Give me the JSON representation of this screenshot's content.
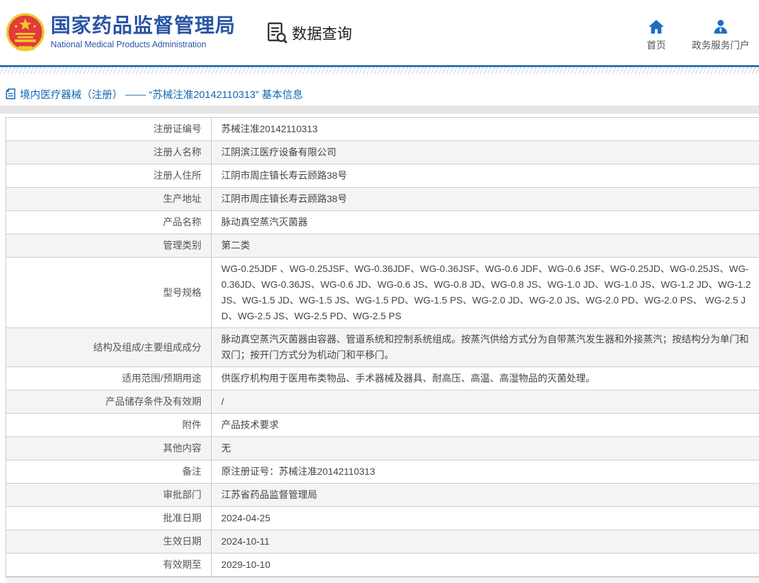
{
  "header": {
    "logo": {
      "title_cn": "国家药品监督管理局",
      "title_en": "National Medical Products Administration"
    },
    "section": {
      "label": "数据查询"
    },
    "nav": [
      {
        "label": "首页",
        "icon": "home-icon"
      },
      {
        "label": "政务服务门户",
        "icon": "user-icon"
      }
    ]
  },
  "breadcrumb": {
    "text": "境内医疗器械（注册） —— “苏械注准20142110313” 基本信息"
  },
  "table": {
    "rows": [
      {
        "label": "注册证编号",
        "value": "苏械注准20142110313"
      },
      {
        "label": "注册人名称",
        "value": "江阴滨江医疗设备有限公司"
      },
      {
        "label": "注册人住所",
        "value": "江阴市周庄镇长寿云顾路38号"
      },
      {
        "label": "生产地址",
        "value": "江阴市周庄镇长寿云顾路38号"
      },
      {
        "label": "产品名称",
        "value": "脉动真空蒸汽灭菌器"
      },
      {
        "label": "管理类别",
        "value": "第二类"
      },
      {
        "label": "型号规格",
        "value": "WG-0.25JDF 、WG-0.25JSF、WG-0.36JDF、WG-0.36JSF、WG-0.6 JDF、WG-0.6 JSF、WG-0.25JD、WG-0.25JS、WG-0.36JD、WG-0.36JS、WG-0.6 JD、WG-0.6 JS、WG-0.8 JD、WG-0.8 JS、WG-1.0 JD、WG-1.0 JS、WG-1.2 JD、WG-1.2 JS、WG-1.5 JD、WG-1.5 JS、WG-1.5 PD、WG-1.5 PS、WG-2.0 JD、WG-2.0 JS、WG-2.0 PD、WG-2.0 PS、 WG-2.5 JD、WG-2.5 JS、WG-2.5 PD、WG-2.5 PS"
      },
      {
        "label": "结构及组成/主要组成成分",
        "value": "脉动真空蒸汽灭菌器由容器、管道系统和控制系统组成。按蒸汽供给方式分为自带蒸汽发生器和外接蒸汽；按结构分为单门和双门；按开门方式分为机动门和平移门。"
      },
      {
        "label": "适用范围/预期用途",
        "value": "供医疗机构用于医用布类物品、手术器械及器具、耐高压、高温、高湿物品的灭菌处理。"
      },
      {
        "label": "产品储存条件及有效期",
        "value": "/"
      },
      {
        "label": "附件",
        "value": "产品技术要求"
      },
      {
        "label": "其他内容",
        "value": "无"
      },
      {
        "label": "备注",
        "value": "原注册证号：苏械注准20142110313"
      },
      {
        "label": "审批部门",
        "value": "江苏省药品监督管理局"
      },
      {
        "label": "批准日期",
        "value": "2024-04-25"
      },
      {
        "label": "生效日期",
        "value": "2024-10-11"
      },
      {
        "label": "有效期至",
        "value": "2029-10-10"
      }
    ]
  },
  "colors": {
    "brand_blue": "#2a55a5",
    "link_blue": "#1068b2",
    "icon_blue": "#1b6ec2",
    "rule_blue": "#2e74b5",
    "row_alt_gray": "#f4f4f4",
    "border_gray": "#cccccc",
    "emblem_red": "#e03c3c",
    "emblem_gold": "#f2c431"
  }
}
